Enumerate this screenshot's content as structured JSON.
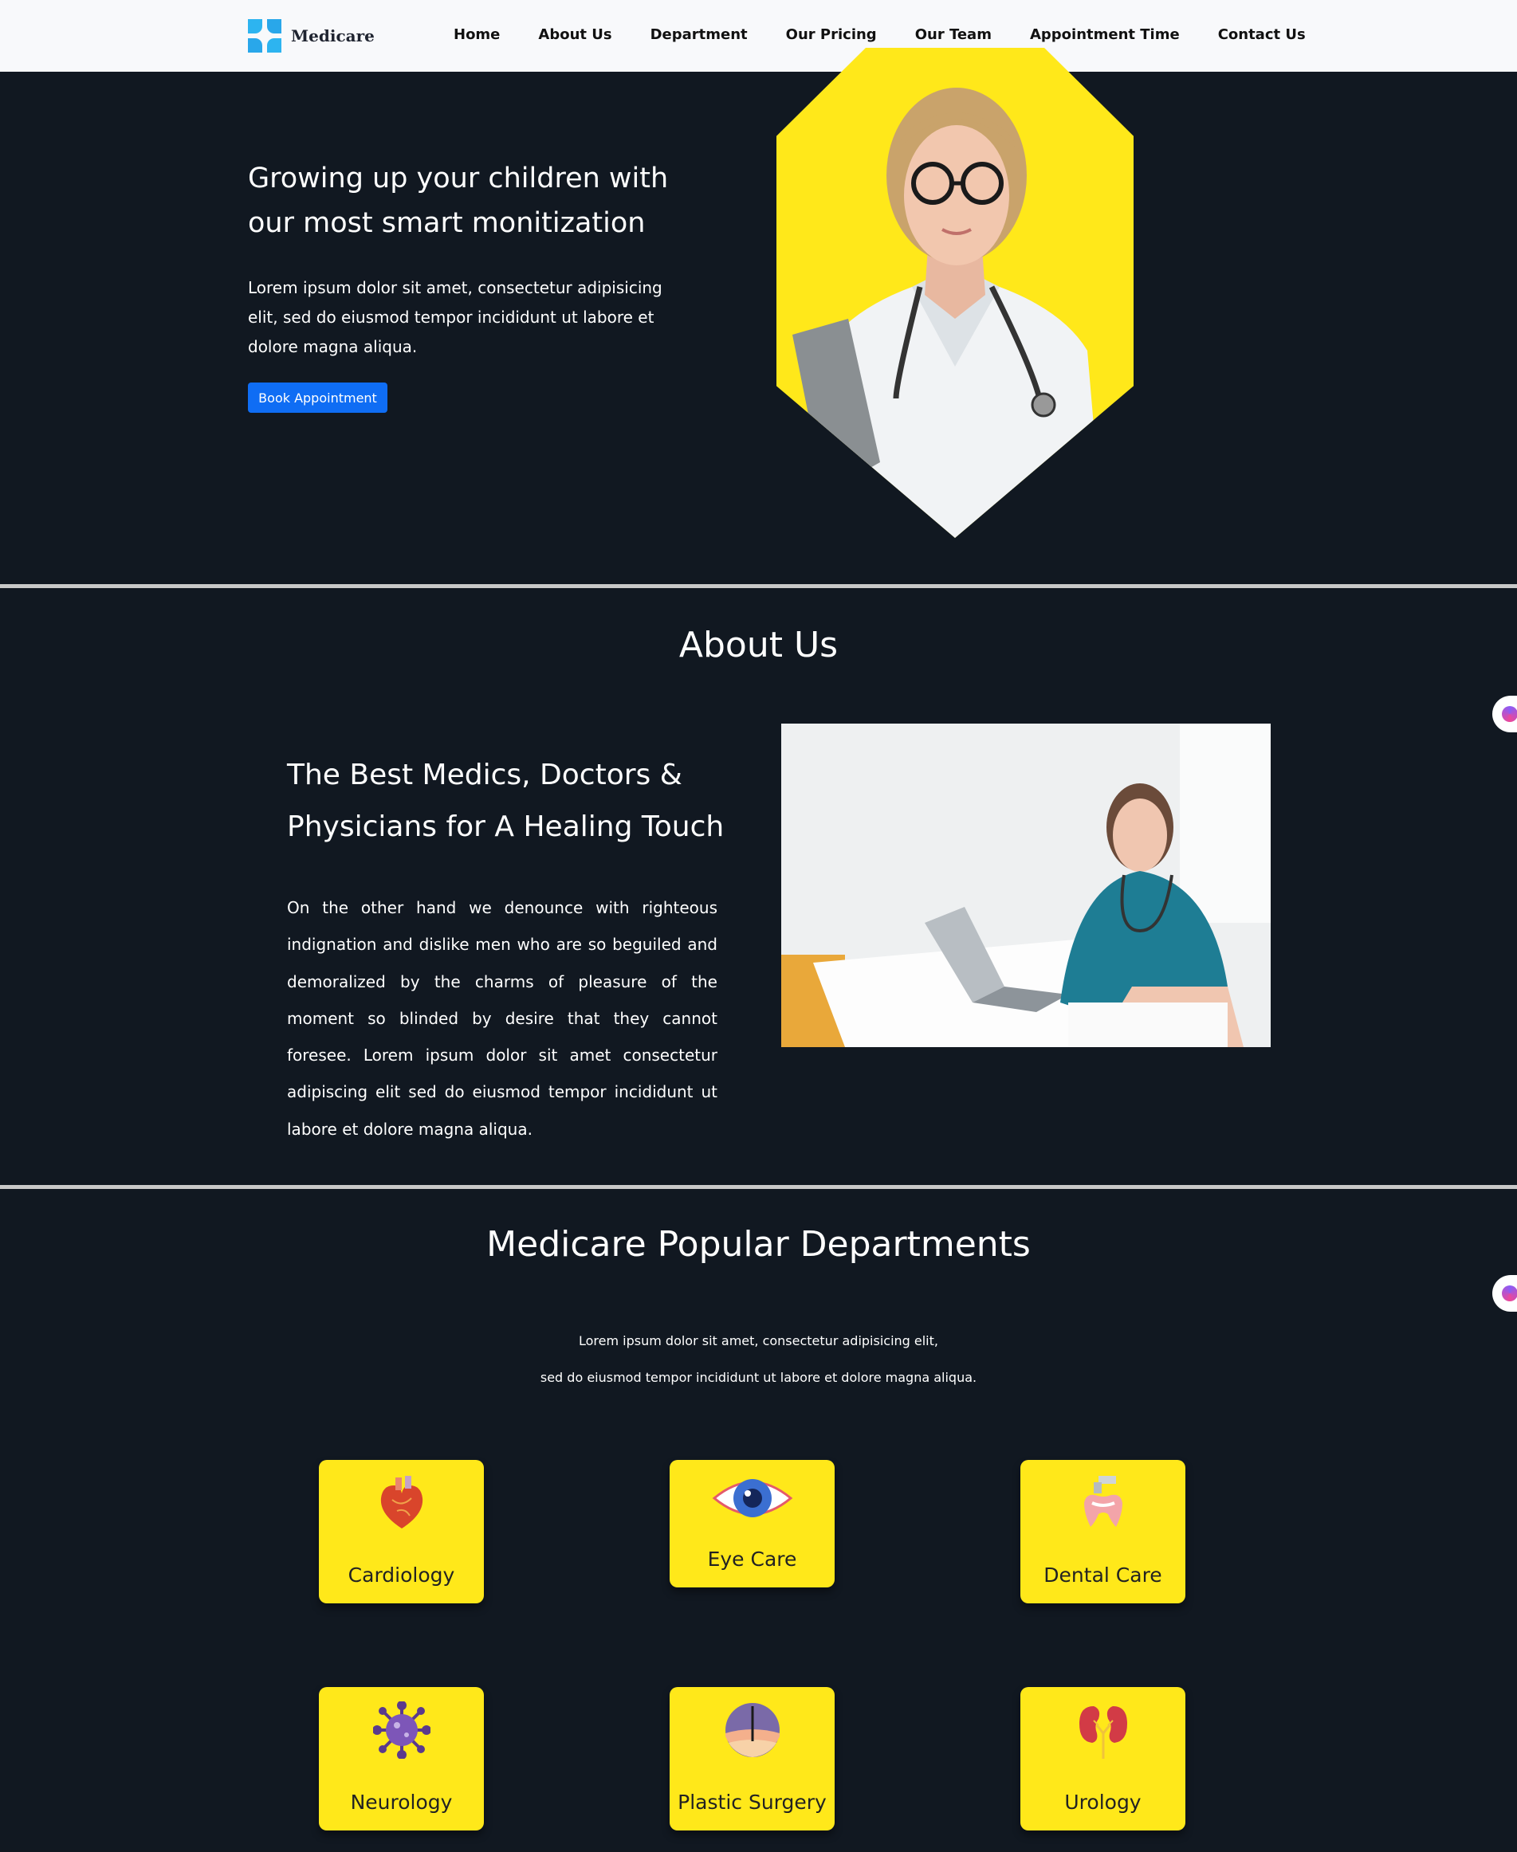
{
  "nav": {
    "brand": "Medicare",
    "items": [
      "Home",
      "About Us",
      "Department",
      "Our Pricing",
      "Our Team",
      "Appointment Time",
      "Contact Us"
    ]
  },
  "hero": {
    "title": "Growing up your children with our most smart monitization",
    "text": "Lorem ipsum dolor sit amet, consectetur adipisicing elit, sed do eiusmod tempor incididunt ut labore et dolore magna aliqua.",
    "button": "Book Appointment"
  },
  "about": {
    "title": "About Us",
    "subtitle": "The Best Medics, Doctors & Physicians for A Healing Touch",
    "text": "On the other hand we denounce with righteous indignation and dislike men who are so beguiled and demoralized by the charms of pleasure of the moment so blinded by desire that they cannot foresee. Lorem ipsum dolor sit amet consectetur adipiscing elit sed do eiusmod tempor incididunt ut labore et dolore magna aliqua."
  },
  "departments": {
    "title": "Medicare Popular Departments",
    "line1": "Lorem ipsum dolor sit amet, consectetur adipisicing elit,",
    "line2": "sed do eiusmod tempor incididunt ut labore et dolore magna aliqua.",
    "cards": [
      {
        "label": "Cardiology",
        "icon": "heart-icon"
      },
      {
        "label": "Eye Care",
        "icon": "eye-icon"
      },
      {
        "label": "Dental Care",
        "icon": "tooth-icon"
      },
      {
        "label": "Neurology",
        "icon": "virus-icon"
      },
      {
        "label": "Plastic Surgery",
        "icon": "skin-icon"
      },
      {
        "label": "Urology",
        "icon": "kidney-icon"
      }
    ]
  },
  "colors": {
    "background": "#111821",
    "accent_yellow": "#ffe81a",
    "button_blue": "#0f6df4"
  }
}
